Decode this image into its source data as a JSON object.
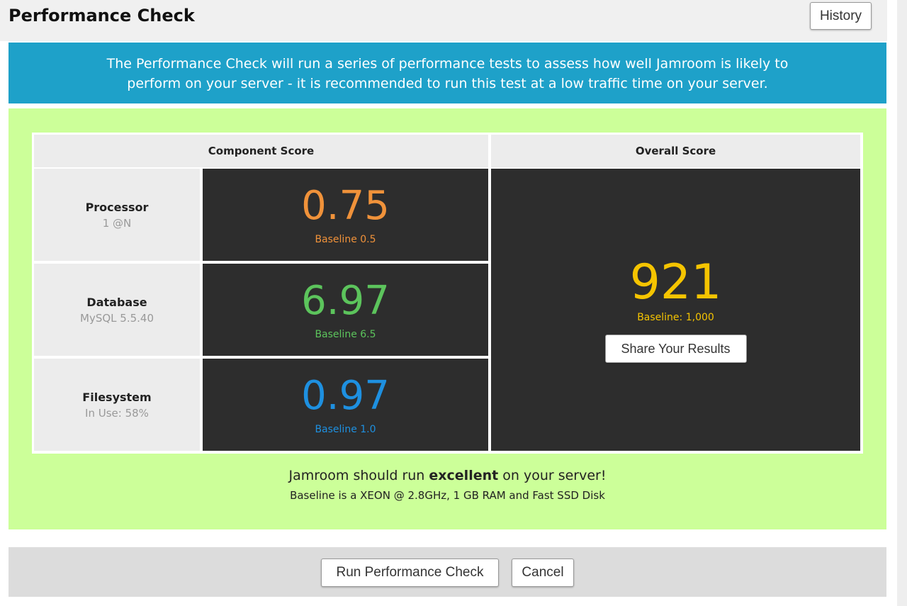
{
  "header": {
    "title": "Performance Check",
    "history_label": "History"
  },
  "banner": {
    "line1": "The Performance Check will run a series of performance tests to assess how well Jamroom is likely to",
    "line2": "perform on your server - it is recommended to run this test at a low traffic time on your server."
  },
  "table": {
    "component_header": "Component Score",
    "overall_header": "Overall Score",
    "rows": [
      {
        "name": "Processor",
        "sub": "1 @N",
        "score": "0.75",
        "baseline": "Baseline 0.5",
        "color": "#f0923a"
      },
      {
        "name": "Database",
        "sub": "MySQL 5.5.40",
        "score": "6.97",
        "baseline": "Baseline 6.5",
        "color": "#5cc45c"
      },
      {
        "name": "Filesystem",
        "sub": "In Use: 58%",
        "score": "0.97",
        "baseline": "Baseline 1.0",
        "color": "#1e90e0"
      }
    ],
    "overall": {
      "score": "921",
      "baseline": "Baseline: 1,000",
      "color": "#f5c400",
      "share_label": "Share Your Results"
    }
  },
  "message": {
    "prefix": "Jamroom should run ",
    "rating": "excellent",
    "suffix": " on your server!",
    "baseline_note": "Baseline is a XEON @ 2.8GHz, 1 GB RAM and Fast SSD Disk"
  },
  "footer": {
    "run_label": "Run Performance Check",
    "cancel_label": "Cancel"
  }
}
